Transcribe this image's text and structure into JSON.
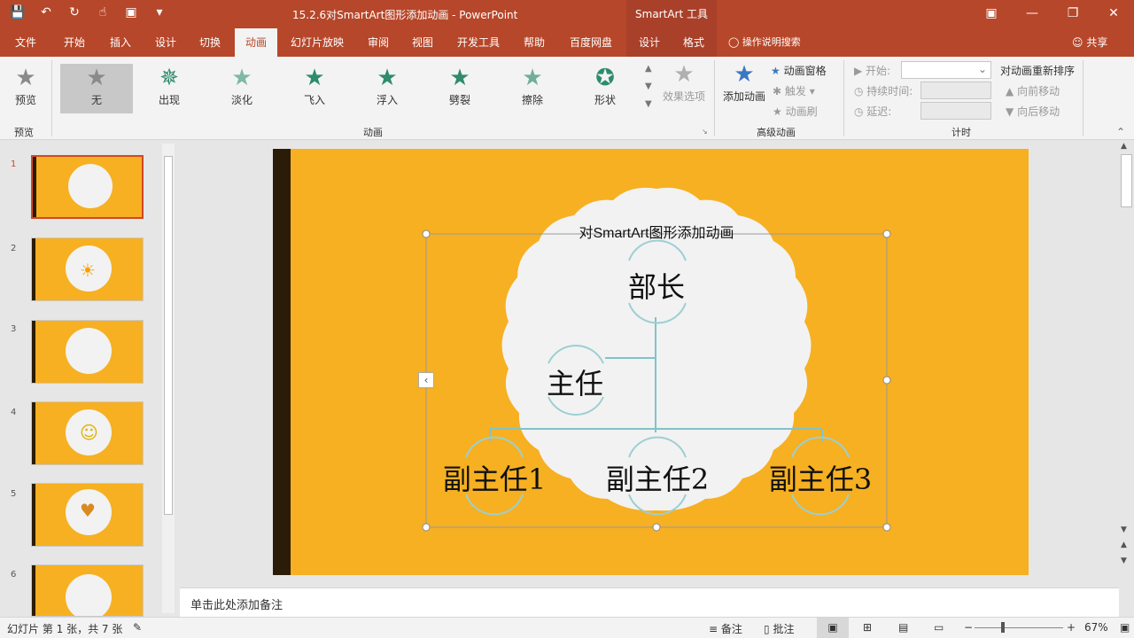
{
  "titlebar": {
    "doc_title": "15.2.6对SmartArt图形添加动画  -  PowerPoint",
    "context_title": "SmartArt 工具",
    "qat": [
      "save-icon",
      "undo-icon",
      "redo-icon",
      "touch-icon",
      "present-icon",
      "customize-icon"
    ],
    "winctl": [
      "ribbon-display-icon",
      "minimize-icon",
      "restore-icon",
      "close-icon"
    ]
  },
  "tabs": [
    "文件",
    "开始",
    "插入",
    "设计",
    "切换",
    "动画",
    "幻灯片放映",
    "审阅",
    "视图",
    "开发工具",
    "帮助",
    "百度网盘",
    "设计",
    "格式"
  ],
  "active_tab": "动画",
  "search_label": "操作说明搜索",
  "share_label": "共享",
  "ribbon": {
    "preview": {
      "label": "预览",
      "group": "预览"
    },
    "animations": [
      {
        "label": "无"
      },
      {
        "label": "出现"
      },
      {
        "label": "淡化"
      },
      {
        "label": "飞入"
      },
      {
        "label": "浮入"
      },
      {
        "label": "劈裂"
      },
      {
        "label": "擦除"
      },
      {
        "label": "形状"
      }
    ],
    "effect_options": "效果选项",
    "animation_group": "动画",
    "add_animation": "添加动画",
    "animation_pane": "动画窗格",
    "trigger": "触发",
    "painter": "动画刷",
    "advanced_group": "高级动画",
    "start_label": "开始:",
    "duration_label": "持续时间:",
    "delay_label": "延迟:",
    "timing_group": "计时",
    "reorder_title": "对动画重新排序",
    "move_earlier": "向前移动",
    "move_later": "向后移动"
  },
  "slides": [
    {
      "num": "1"
    },
    {
      "num": "2"
    },
    {
      "num": "3"
    },
    {
      "num": "4"
    },
    {
      "num": "5"
    },
    {
      "num": "6"
    }
  ],
  "slide": {
    "title": "对SmartArt图形添加动画",
    "nodes": {
      "top": "部长",
      "mid": "主任",
      "b1": "副主任1",
      "b2": "副主任2",
      "b3": "副主任3"
    }
  },
  "notes_placeholder": "单击此处添加备注",
  "status": {
    "slide_info": "幻灯片 第 1 张，共 7 张",
    "notes": "备注",
    "comments": "批注",
    "zoom": "67%"
  },
  "colors": {
    "brand": "#b7472a",
    "slide_bg": "#f6b021",
    "dark_bar": "#2b1c07",
    "accent_teal": "#2e8b6e"
  }
}
